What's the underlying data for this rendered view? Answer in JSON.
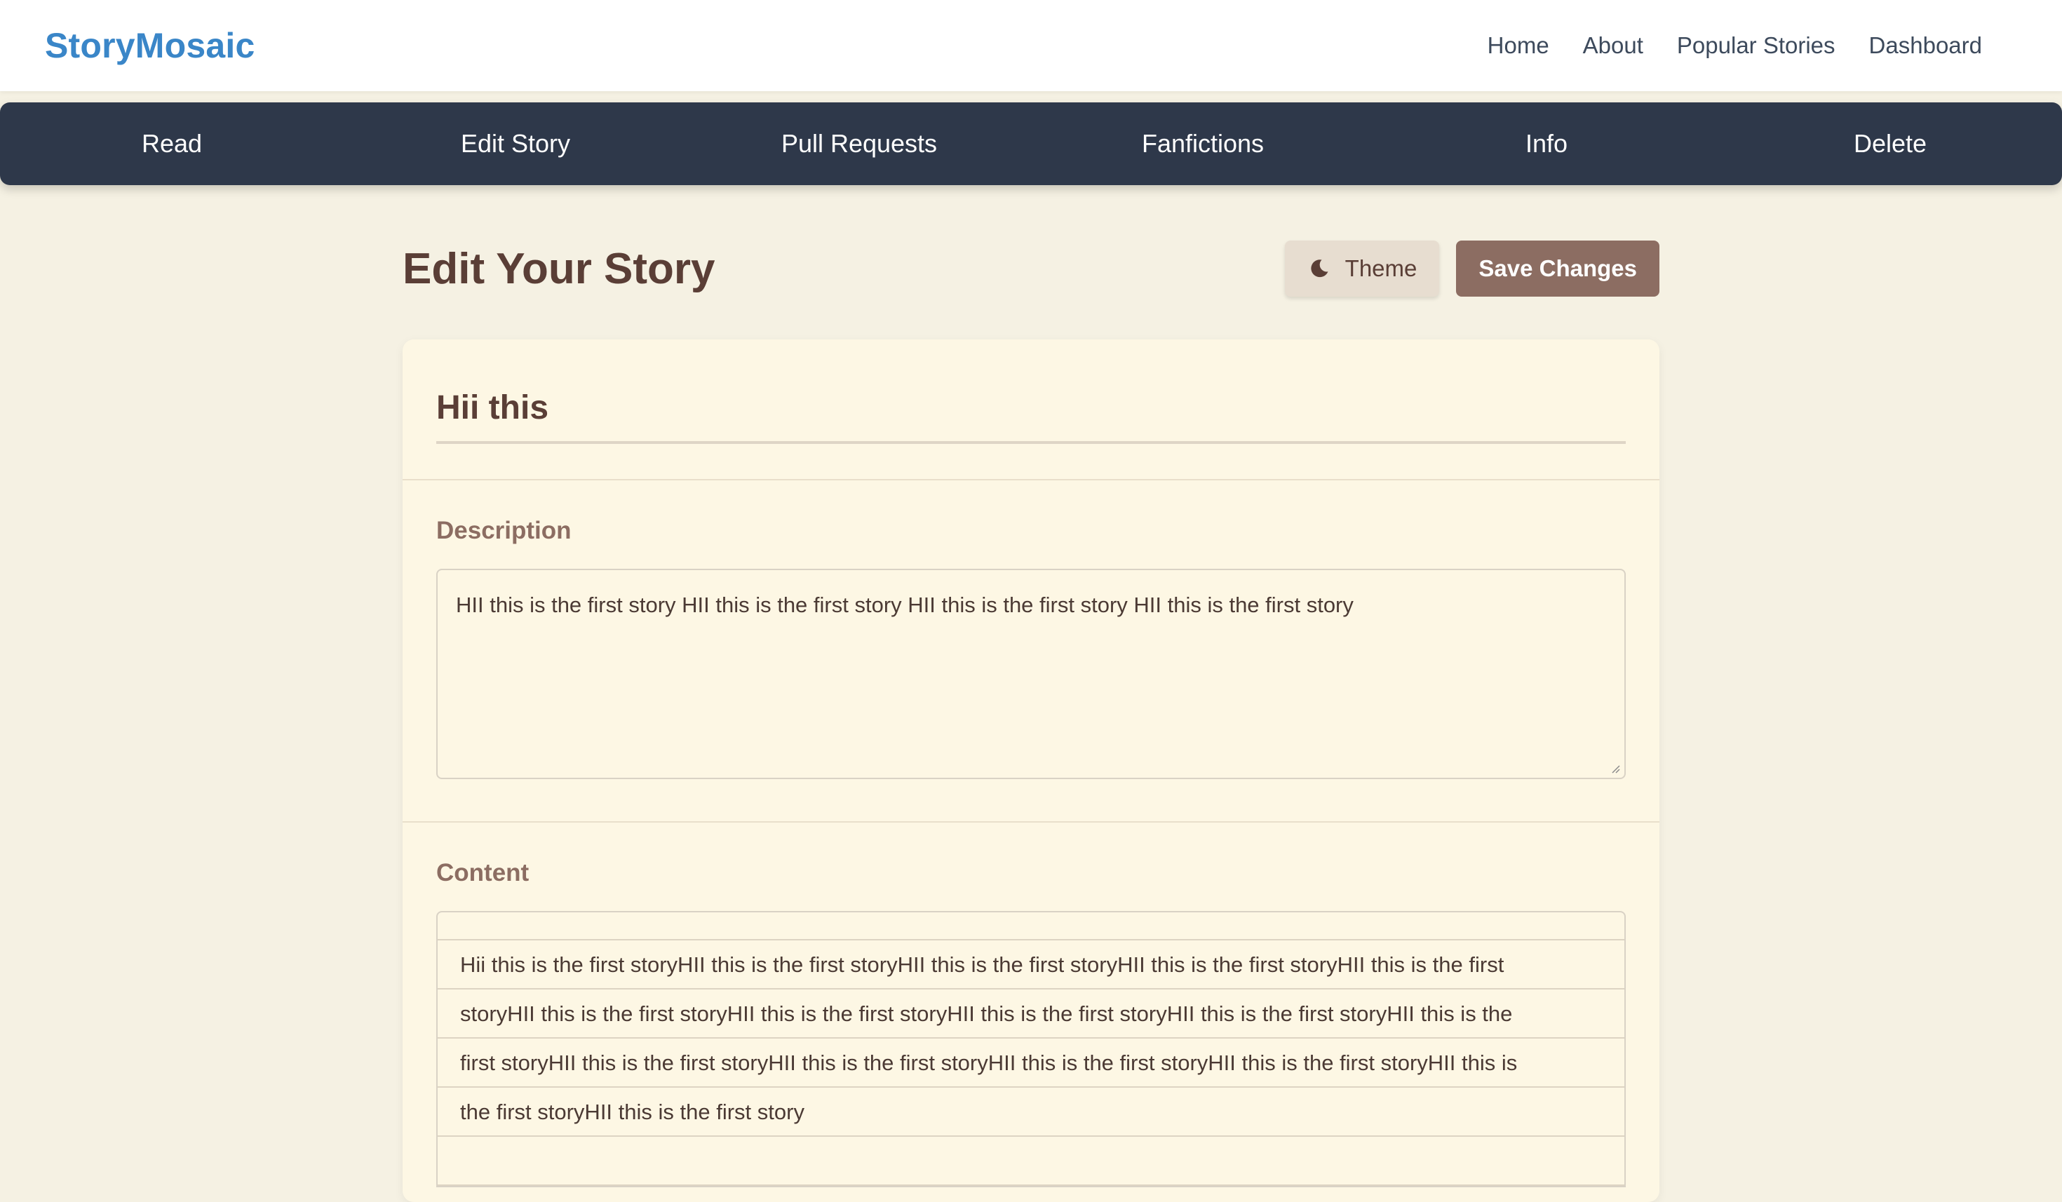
{
  "header": {
    "brand": "StoryMosaic",
    "nav": [
      "Home",
      "About",
      "Popular Stories",
      "Dashboard"
    ]
  },
  "tabs": [
    "Read",
    "Edit Story",
    "Pull Requests",
    "Fanfictions",
    "Info",
    "Delete"
  ],
  "page": {
    "title": "Edit Your Story",
    "theme_button": "Theme",
    "save_button": "Save Changes"
  },
  "story": {
    "title": "Hii this",
    "description_label": "Description",
    "description": "HII this is the first story HII this is the first story HII this is the first story HII this is the first story",
    "content_label": "Content",
    "content_lines": [
      "Hii this is the first storyHII this is the first storyHII this is the first storyHII this is the first storyHII this is the first",
      "storyHII this is the first storyHII this is the first storyHII this is the first storyHII this is the first storyHII this is the",
      "first storyHII this is the first storyHII this is the first storyHII this is the first storyHII this is the first storyHII this is",
      "the first storyHII this is the first story"
    ]
  },
  "colors": {
    "brand": "#3a86c8",
    "tabbar": "#2e384a",
    "background": "#f5f1e3",
    "card": "#fdf7e4",
    "accent": "#8c6d62",
    "text": "#5a3e36"
  },
  "icons": {
    "theme": "moon-icon"
  }
}
